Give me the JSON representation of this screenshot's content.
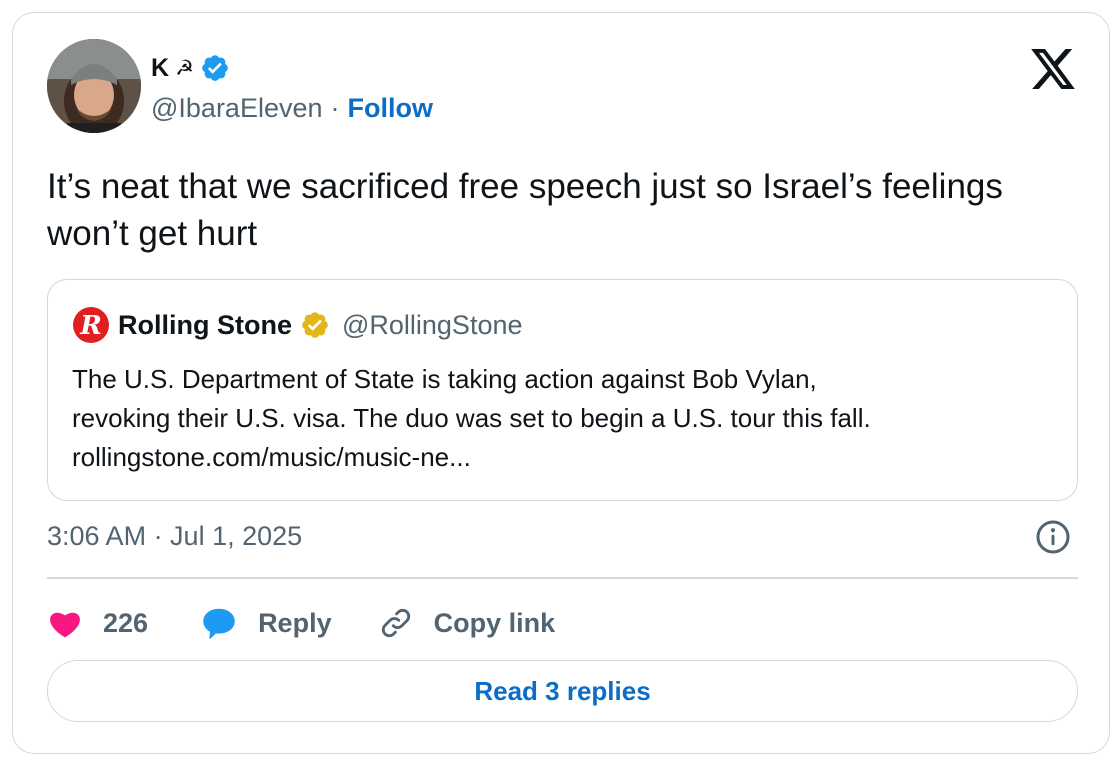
{
  "author": {
    "name": "K",
    "name_symbol": "☭",
    "handle": "@IbaraEleven",
    "separator": "·",
    "follow_label": "Follow",
    "verified_icon": "verified-badge-icon"
  },
  "tweet": {
    "text": "It’s neat that we sacrificed free speech just so Israel’s feelings won’t get hurt"
  },
  "quote": {
    "name": "Rolling Stone",
    "handle": "@RollingStone",
    "logo_letter": "R",
    "lines": [
      "The U.S. Department of State is taking action against Bob Vylan,",
      "revoking their U.S. visa. The duo was set to begin a U.S. tour this fall.",
      "rollingstone.com/music/music-ne..."
    ]
  },
  "meta": {
    "timestamp": "3:06 AM · Jul 1, 2025"
  },
  "actions": {
    "like_count": "226",
    "reply_label": "Reply",
    "copy_label": "Copy link"
  },
  "read_replies_label": "Read 3 replies",
  "colors": {
    "accent_blue": "#0c6dc7",
    "like_pink": "#f91880",
    "reply_blue": "#1d9bf0",
    "gold_badge": "#e2b719",
    "muted_text": "#536471",
    "border": "#cfd9de",
    "rolling_stone_red": "#e02020"
  }
}
